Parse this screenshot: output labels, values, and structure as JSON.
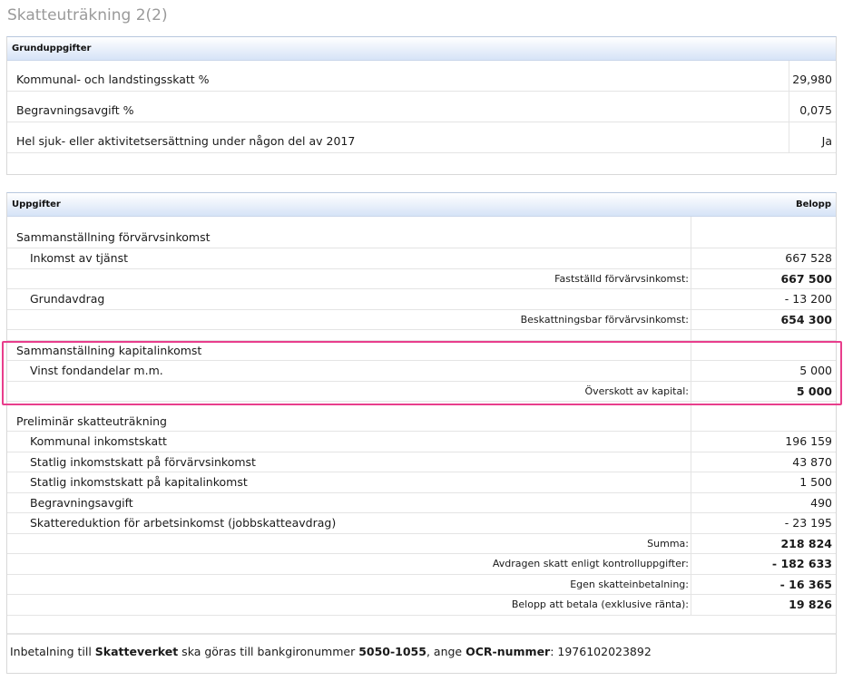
{
  "page": {
    "title": "Skatteuträkning 2(2)"
  },
  "grund": {
    "header": "Grunduppgifter",
    "rows": [
      {
        "label": "Kommunal- och landstingsskatt %",
        "value": "29,980"
      },
      {
        "label": "Begravningsavgift %",
        "value": "0,075"
      },
      {
        "label": "Hel sjuk- eller aktivitetsersättning under någon del av 2017",
        "value": "Ja"
      }
    ]
  },
  "uppgifter": {
    "header_label": "Uppgifter",
    "header_value": "Belopp",
    "forvarv": {
      "title": "Sammanställning förvärvsinkomst",
      "inkomst_tjanst_label": "Inkomst av tjänst",
      "inkomst_tjanst_value": "667 528",
      "faststalld_label": "Fastställd förvärvsinkomst:",
      "faststalld_value": "667 500",
      "grundavdrag_label": "Grundavdrag",
      "grundavdrag_value": "- 13 200",
      "beskattningsbar_label": "Beskattningsbar förvärvsinkomst:",
      "beskattningsbar_value": "654 300"
    },
    "kapital": {
      "title": "Sammanställning kapitalinkomst",
      "vinst_label": "Vinst fondandelar m.m.",
      "vinst_value": "5 000",
      "overskott_label": "Överskott av kapital:",
      "overskott_value": "5 000"
    },
    "prelim": {
      "title": "Preliminär skatteuträkning",
      "items": [
        {
          "label": "Kommunal inkomstskatt",
          "value": "196 159"
        },
        {
          "label": "Statlig inkomstskatt på förvärvsinkomst",
          "value": "43 870"
        },
        {
          "label": "Statlig inkomstskatt på kapitalinkomst",
          "value": "1 500"
        },
        {
          "label": "Begravningsavgift",
          "value": "490"
        },
        {
          "label": "Skattereduktion för arbetsinkomst (jobbskatteavdrag)",
          "value": "- 23 195"
        }
      ],
      "sums": [
        {
          "label": "Summa:",
          "value": "218 824"
        },
        {
          "label": "Avdragen skatt enligt kontrolluppgifter:",
          "value": "- 182 633"
        },
        {
          "label": "Egen skatteinbetalning:",
          "value": "- 16 365"
        },
        {
          "label": "Belopp att betala (exklusive ränta):",
          "value": "19 826"
        }
      ]
    },
    "footer": {
      "t1": "Inbetalning till ",
      "b1": "Skatteverket",
      "t2": " ska göras till bankgironummer ",
      "b2": "5050-1055",
      "t3": ", ange ",
      "b3": "OCR-nummer",
      "t4": ": 1976102023892"
    }
  },
  "colors": {
    "highlight": "#e83e8c",
    "header_gradient": "#d6e4f7",
    "title_gray": "#9a9a9a"
  }
}
